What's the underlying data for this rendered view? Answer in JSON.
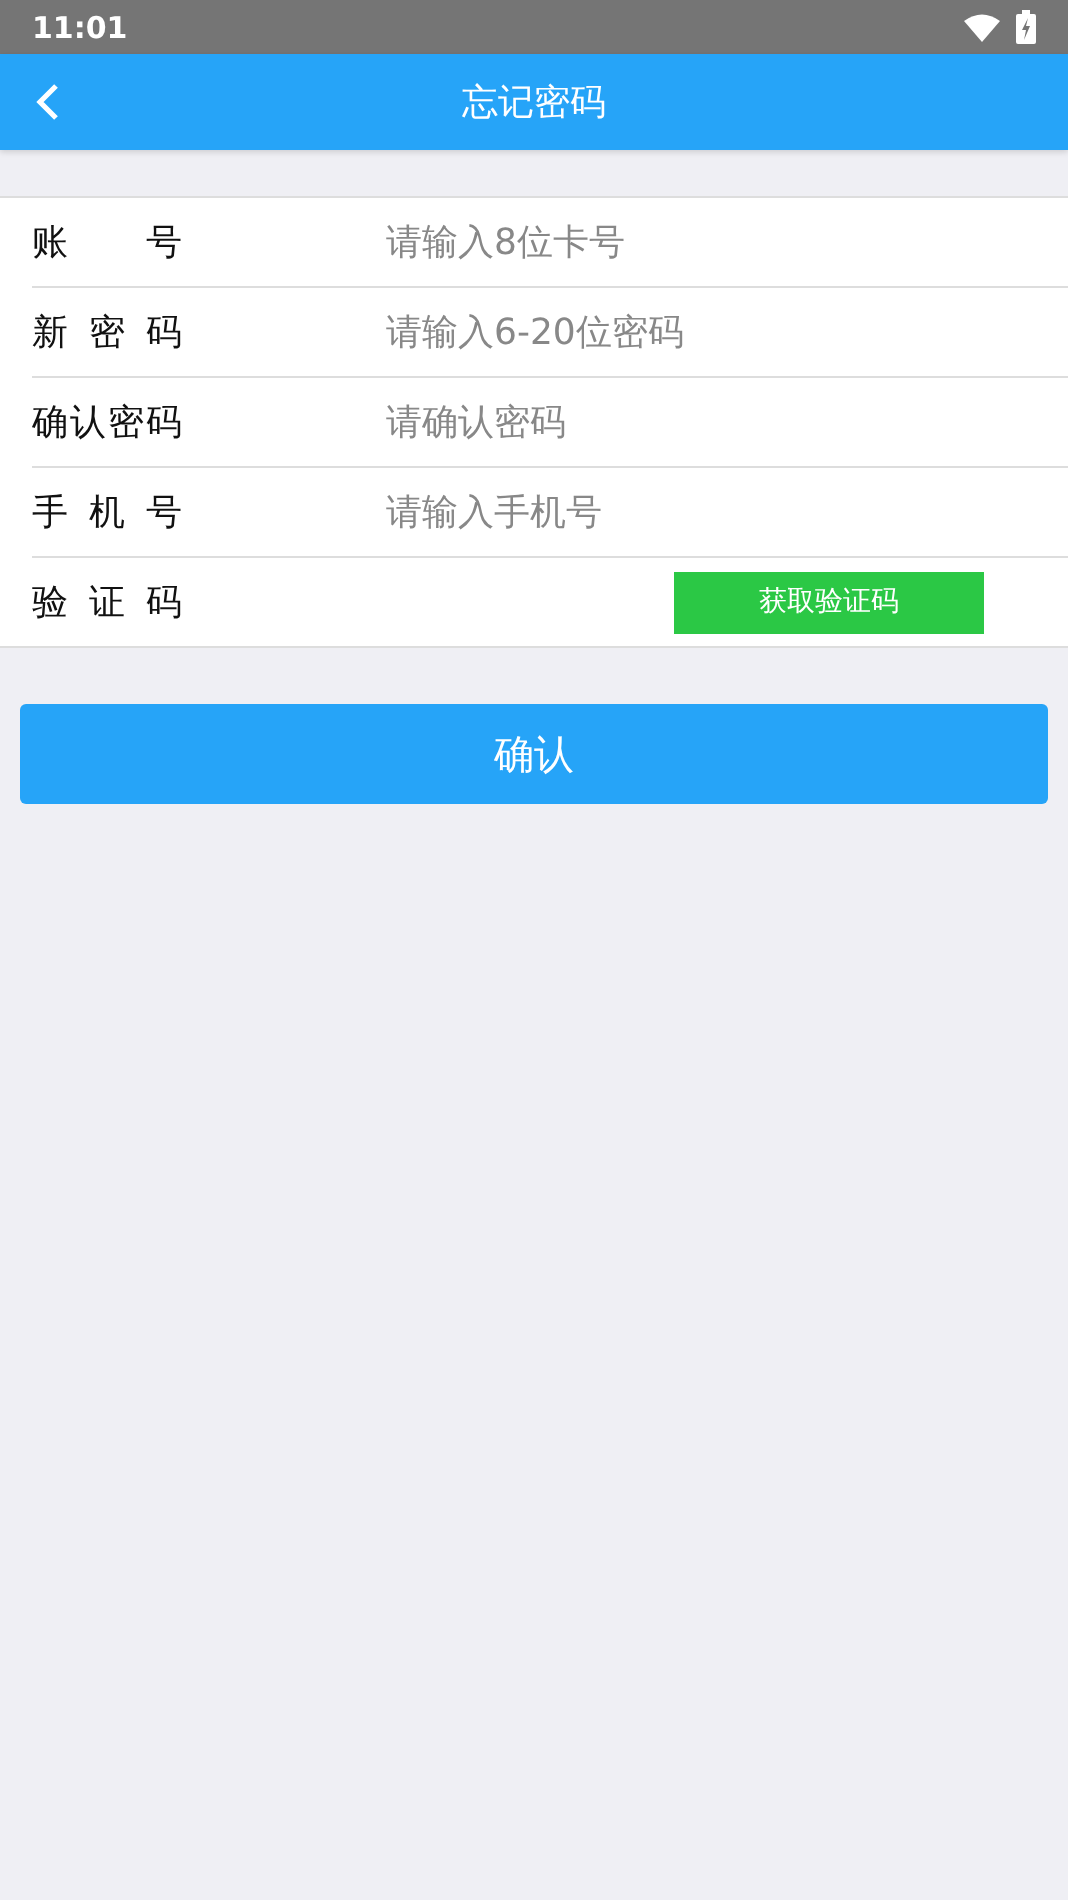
{
  "status_bar": {
    "time": "11:01"
  },
  "header": {
    "title": "忘记密码"
  },
  "form": {
    "rows": [
      {
        "kind": "input",
        "label": "账 号",
        "placeholder": "请输入8位卡号"
      },
      {
        "kind": "input",
        "label": "新 密 码",
        "placeholder": "请输入6-20位密码"
      },
      {
        "kind": "input",
        "label": "确认密码",
        "placeholder": "请确认密码"
      },
      {
        "kind": "input",
        "label": "手 机 号",
        "placeholder": "请输入手机号"
      },
      {
        "kind": "code",
        "label": "验 证 码",
        "button": "获取验证码"
      }
    ]
  },
  "confirm_button": "确认"
}
